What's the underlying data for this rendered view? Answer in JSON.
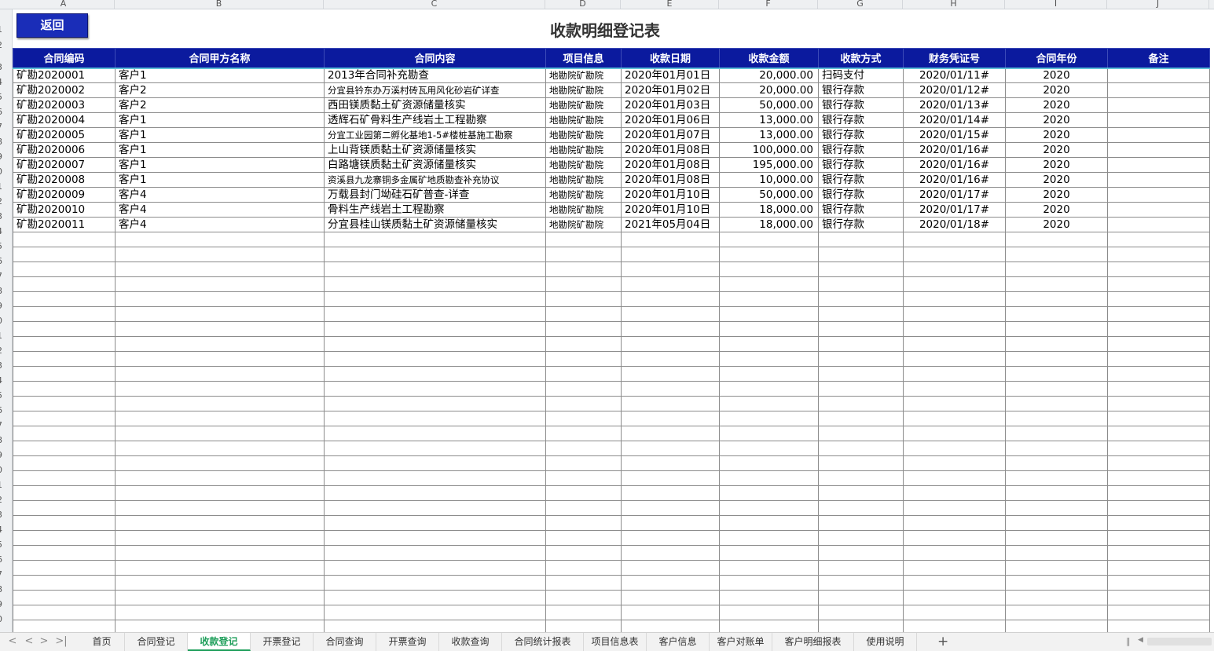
{
  "columns": [
    "A",
    "B",
    "C",
    "D",
    "E",
    "F",
    "G",
    "H",
    "I",
    "J"
  ],
  "back_button": "返回",
  "title": "收款明细登记表",
  "headers": [
    "合同编码",
    "合同甲方名称",
    "合同内容",
    "项目信息",
    "收款日期",
    "收款金额",
    "收款方式",
    "财务凭证号",
    "合同年份",
    "备注"
  ],
  "rows": [
    [
      "矿勘2020001",
      "客户1",
      "2013年合同补充勘查",
      "地勘院矿勘院",
      "2020年01月01日",
      "20,000.00",
      "扫码支付",
      "2020/01/11#",
      "2020",
      ""
    ],
    [
      "矿勘2020002",
      "客户2",
      "分宜县钤东办万溪村砖瓦用风化砂岩矿详查",
      "地勘院矿勘院",
      "2020年01月02日",
      "20,000.00",
      "银行存款",
      "2020/01/12#",
      "2020",
      ""
    ],
    [
      "矿勘2020003",
      "客户2",
      "西田镁质黏土矿资源储量核实",
      "地勘院矿勘院",
      "2020年01月03日",
      "50,000.00",
      "银行存款",
      "2020/01/13#",
      "2020",
      ""
    ],
    [
      "矿勘2020004",
      "客户1",
      "透辉石矿骨料生产线岩土工程勘察",
      "地勘院矿勘院",
      "2020年01月06日",
      "13,000.00",
      "银行存款",
      "2020/01/14#",
      "2020",
      ""
    ],
    [
      "矿勘2020005",
      "客户1",
      "分宜工业园第二孵化基地1-5#楼桩基施工勘察",
      "地勘院矿勘院",
      "2020年01月07日",
      "13,000.00",
      "银行存款",
      "2020/01/15#",
      "2020",
      ""
    ],
    [
      "矿勘2020006",
      "客户1",
      "上山背镁质黏土矿资源储量核实",
      "地勘院矿勘院",
      "2020年01月08日",
      "100,000.00",
      "银行存款",
      "2020/01/16#",
      "2020",
      ""
    ],
    [
      "矿勘2020007",
      "客户1",
      "白路塘镁质黏土矿资源储量核实",
      "地勘院矿勘院",
      "2020年01月08日",
      "195,000.00",
      "银行存款",
      "2020/01/16#",
      "2020",
      ""
    ],
    [
      "矿勘2020008",
      "客户1",
      "资溪县九龙寨铜多金属矿地质勘查补充协议",
      "地勘院矿勘院",
      "2020年01月08日",
      "10,000.00",
      "银行存款",
      "2020/01/16#",
      "2020",
      ""
    ],
    [
      "矿勘2020009",
      "客户4",
      "万载县封门坳硅石矿普查-详查",
      "地勘院矿勘院",
      "2020年01月10日",
      "50,000.00",
      "银行存款",
      "2020/01/17#",
      "2020",
      ""
    ],
    [
      "矿勘2020010",
      "客户4",
      "骨料生产线岩土工程勘察",
      "地勘院矿勘院",
      "2020年01月10日",
      "18,000.00",
      "银行存款",
      "2020/01/17#",
      "2020",
      ""
    ],
    [
      "矿勘2020011",
      "客户4",
      "分宜县桂山镁质黏土矿资源储量核实",
      "地勘院矿勘院",
      "2021年05月04日",
      "18,000.00",
      "银行存款",
      "2020/01/18#",
      "2020",
      ""
    ]
  ],
  "row_numbers": [
    "1",
    "2",
    "3",
    "4",
    "5",
    "6",
    "7",
    "8",
    "9",
    "0",
    "1",
    "2",
    "3",
    "4",
    "5",
    "6",
    "7",
    "8",
    "9",
    "0",
    "1",
    "2",
    "3",
    "4",
    "5",
    "6",
    "7",
    "8",
    "9",
    "0",
    "1",
    "2",
    "3",
    "4",
    "5",
    "6",
    "7",
    "8",
    "9",
    "0"
  ],
  "sheet_tabs": [
    "首页",
    "合同登记",
    "收款登记",
    "开票登记",
    "合同查询",
    "开票查询",
    "收款查询",
    "合同统计报表",
    "项目信息表",
    "客户信息",
    "客户对账单",
    "客户明细报表",
    "使用说明"
  ],
  "active_tab": "收款登记",
  "nav_arrows": [
    "<",
    "<",
    ">",
    ">|"
  ],
  "add_sheet": "+"
}
